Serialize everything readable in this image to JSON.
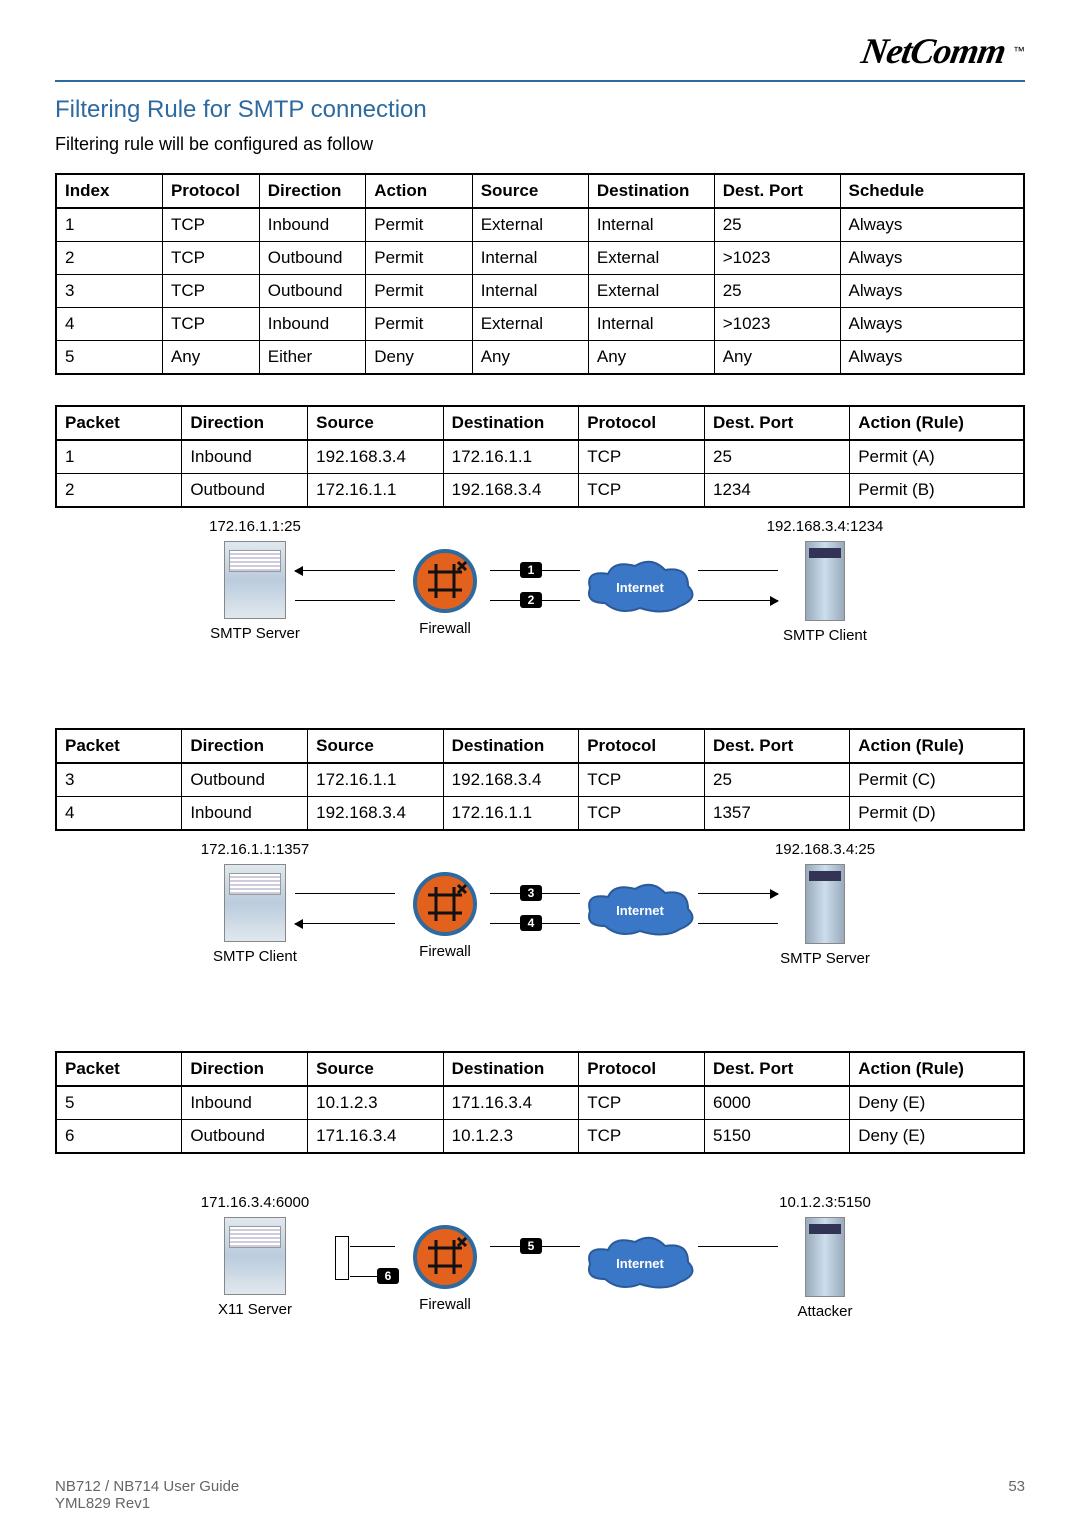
{
  "brand": {
    "name": "NetComm",
    "tm": "™"
  },
  "title": "Filtering Rule for SMTP connection",
  "lead": "Filtering rule will be configured as follow",
  "table_rules": {
    "headers": [
      "Index",
      "Protocol",
      "Direction",
      "Action",
      "Source",
      "Destination",
      "Dest. Port",
      "Schedule"
    ],
    "rows": [
      [
        "1",
        "TCP",
        "Inbound",
        "Permit",
        "External",
        "Internal",
        "25",
        "Always"
      ],
      [
        "2",
        "TCP",
        "Outbound",
        "Permit",
        "Internal",
        "External",
        ">1023",
        "Always"
      ],
      [
        "3",
        "TCP",
        "Outbound",
        "Permit",
        "Internal",
        "External",
        "25",
        "Always"
      ],
      [
        "4",
        "TCP",
        "Inbound",
        "Permit",
        "External",
        "Internal",
        ">1023",
        "Always"
      ],
      [
        "5",
        "Any",
        "Either",
        "Deny",
        "Any",
        "Any",
        "Any",
        "Always"
      ]
    ]
  },
  "packet_headers": [
    "Packet",
    "Direction",
    "Source",
    "Destination",
    "Protocol",
    "Dest. Port",
    "Action (Rule)"
  ],
  "packets_a": {
    "rows": [
      [
        "1",
        "Inbound",
        "192.168.3.4",
        "172.16.1.1",
        "TCP",
        "25",
        "Permit (A)"
      ],
      [
        "2",
        "Outbound",
        "172.16.1.1",
        "192.168.3.4",
        "TCP",
        "1234",
        "Permit (B)"
      ]
    ]
  },
  "packets_b": {
    "rows": [
      [
        "3",
        "Outbound",
        "172.16.1.1",
        "192.168.3.4",
        "TCP",
        "25",
        "Permit (C)"
      ],
      [
        "4",
        "Inbound",
        "192.168.3.4",
        "172.16.1.1",
        "TCP",
        "1357",
        "Permit (D)"
      ]
    ]
  },
  "packets_c": {
    "rows": [
      [
        "5",
        "Inbound",
        "10.1.2.3",
        "171.16.3.4",
        "TCP",
        "6000",
        "Deny (E)"
      ],
      [
        "6",
        "Outbound",
        "171.16.3.4",
        "10.1.2.3",
        "TCP",
        "5150",
        "Deny (E)"
      ]
    ]
  },
  "diagram_a": {
    "left_ip": "172.16.1.1:25",
    "left_caption": "SMTP Server",
    "fw_caption": "Firewall",
    "cloud_label": "Internet",
    "right_ip": "192.168.3.4:1234",
    "right_caption": "SMTP Client",
    "badge1": "1",
    "badge2": "2"
  },
  "diagram_b": {
    "left_ip": "172.16.1.1:1357",
    "left_caption": "SMTP Client",
    "fw_caption": "Firewall",
    "cloud_label": "Internet",
    "right_ip": "192.168.3.4:25",
    "right_caption": "SMTP Server",
    "badge1": "3",
    "badge2": "4"
  },
  "diagram_c": {
    "left_ip": "171.16.3.4:6000",
    "left_caption": "X11 Server",
    "fw_caption": "Firewall",
    "cloud_label": "Internet",
    "right_ip": "10.1.2.3:5150",
    "right_caption": "Attacker",
    "badge1": "5",
    "badge2": "6"
  },
  "footer": {
    "left1": "NB712 / NB714 User Guide",
    "left2": "YML829 Rev1",
    "right": "53"
  }
}
